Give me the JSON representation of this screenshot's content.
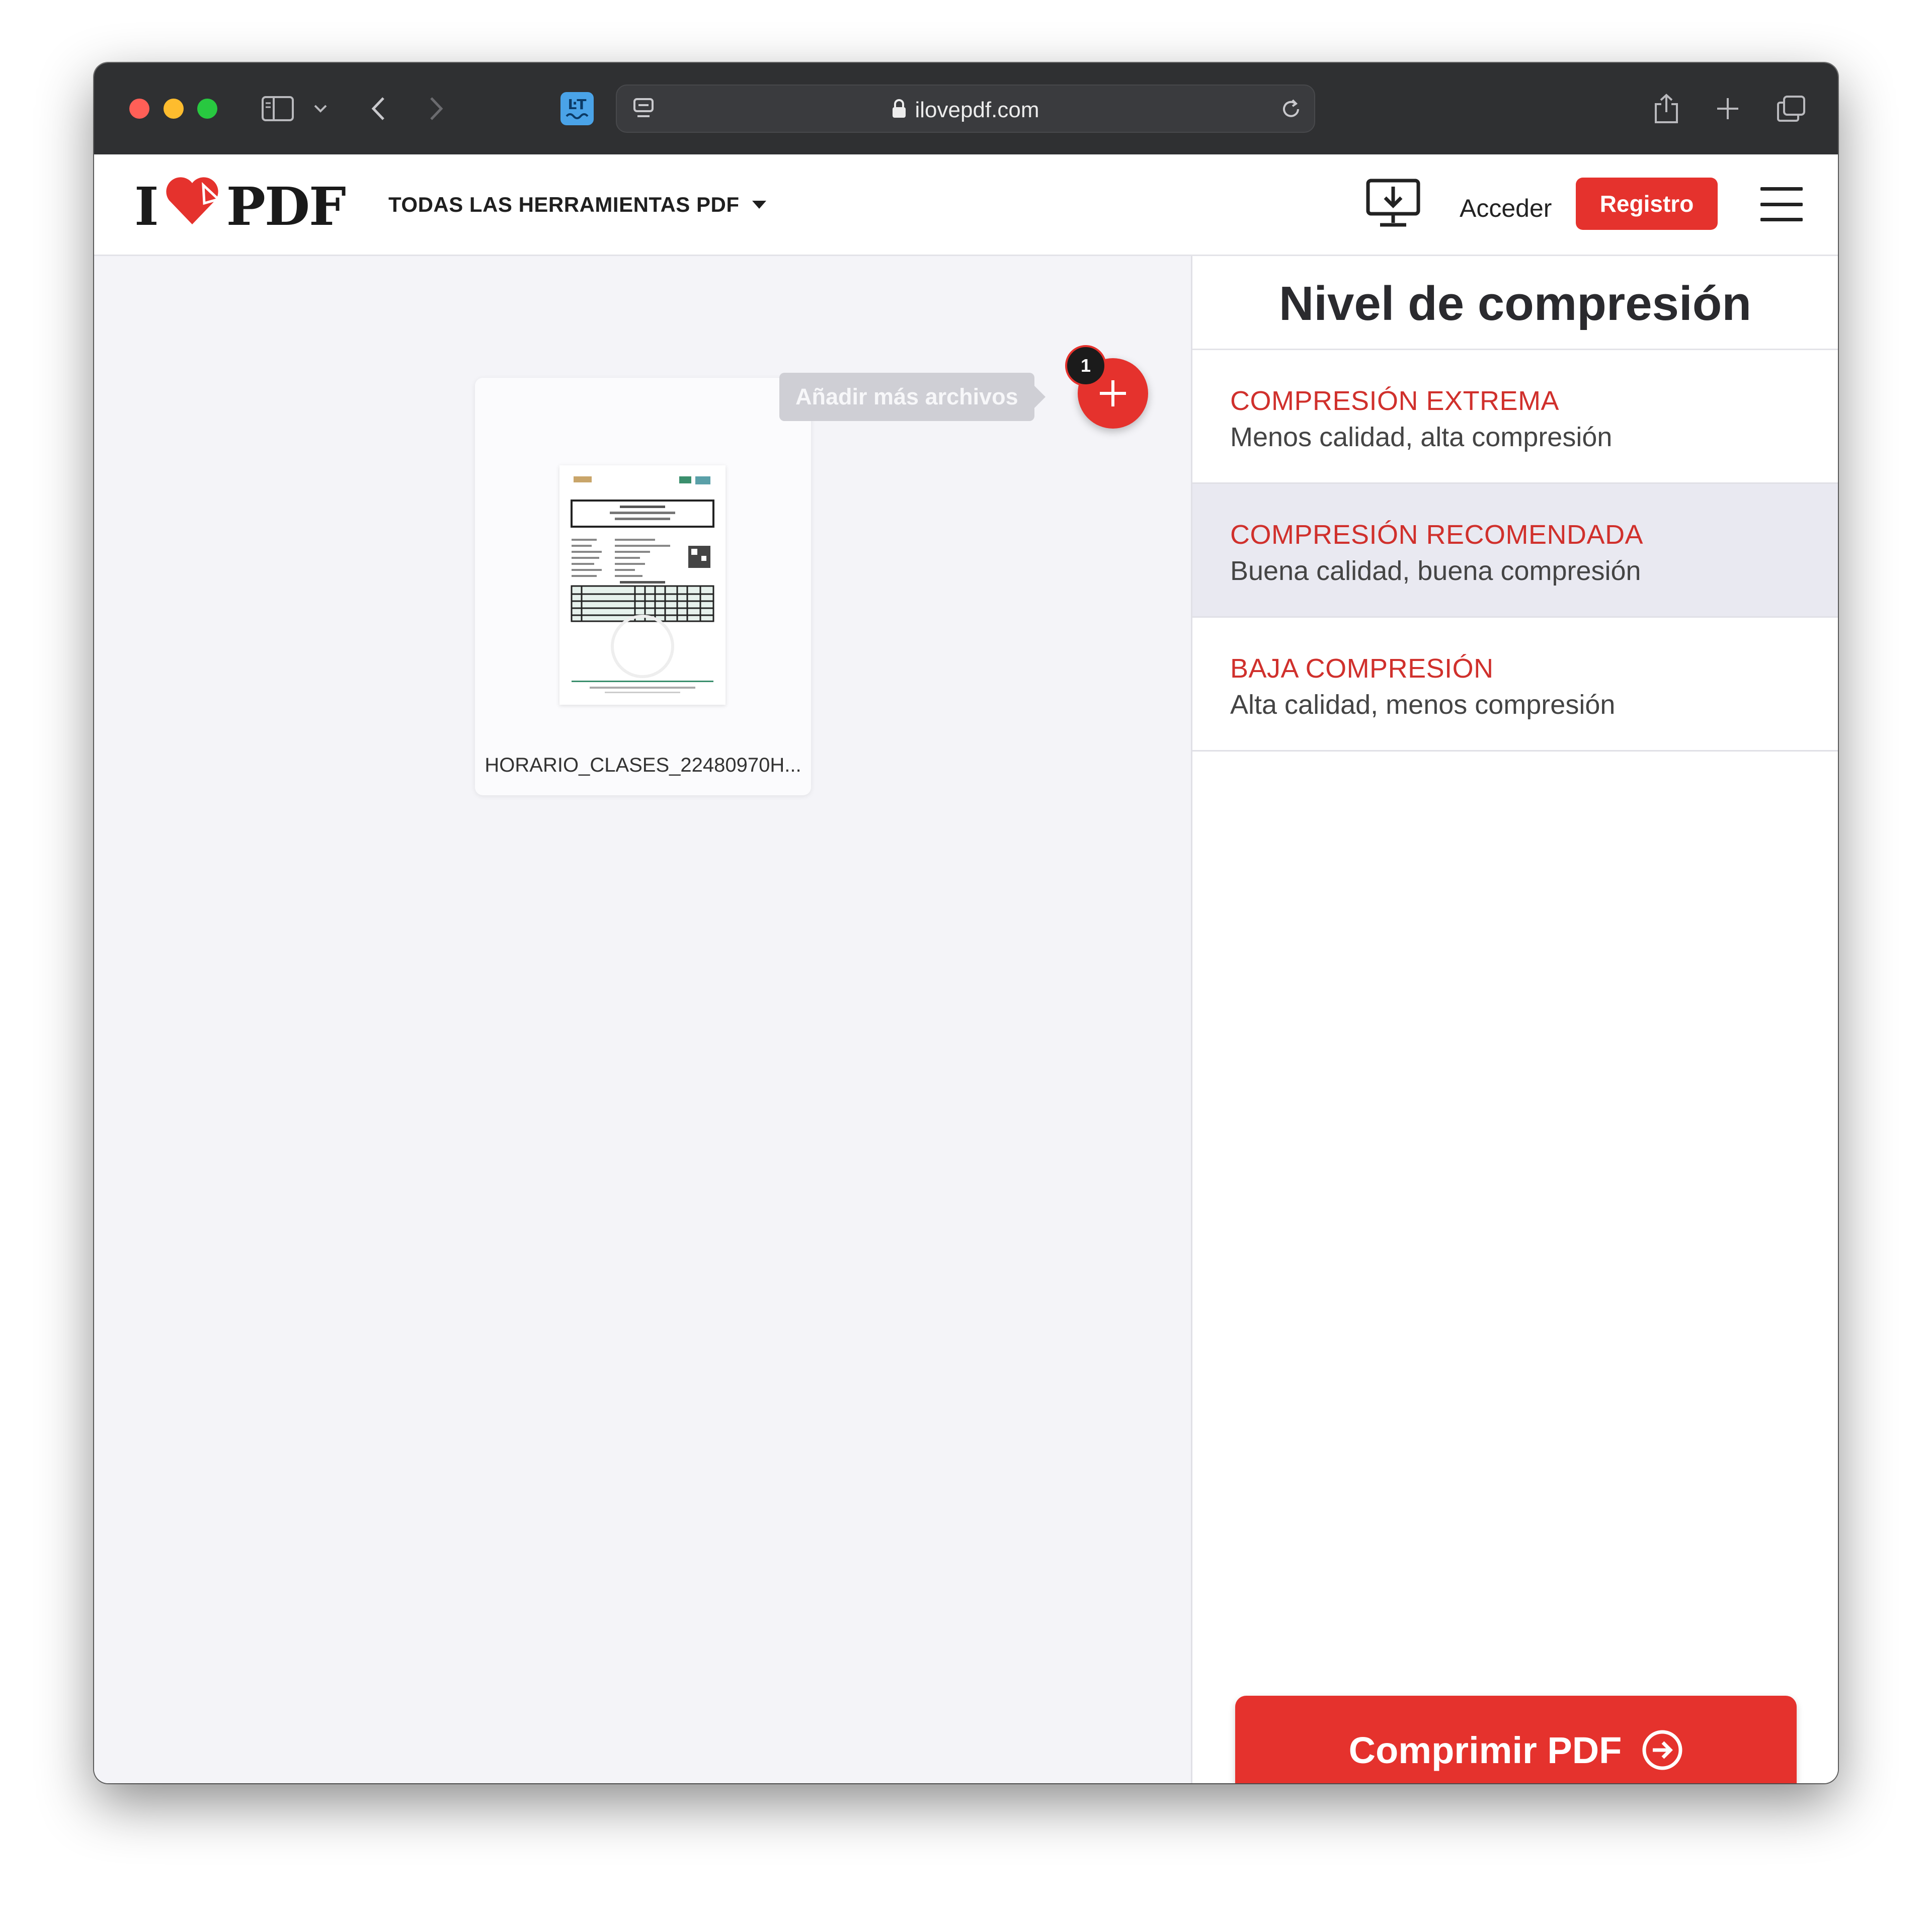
{
  "browser": {
    "url": "ilovepdf.com",
    "icons": [
      "sidebar-icon",
      "chevron-down-icon",
      "back-icon",
      "forward-icon",
      "translate-extension-icon",
      "tab-settings-icon",
      "lock-icon",
      "reload-icon",
      "share-icon",
      "new-tab-icon",
      "tab-overview-icon"
    ]
  },
  "header": {
    "logo_left": "I",
    "logo_right": "PDF",
    "tools_menu_label": "TODAS LAS HERRAMIENTAS PDF",
    "login_label": "Acceder",
    "signup_label": "Registro"
  },
  "workspace": {
    "file_name": "HORARIO_CLASES_22480970H...",
    "add_files_tooltip": "Añadir más archivos",
    "file_count": "1"
  },
  "sidebar": {
    "title": "Nivel de compresión",
    "options": [
      {
        "title": "COMPRESIÓN EXTREMA",
        "description": "Menos calidad, alta compresión",
        "selected": false
      },
      {
        "title": "COMPRESIÓN RECOMENDADA",
        "description": "Buena calidad, buena compresión",
        "selected": true
      },
      {
        "title": "BAJA COMPRESIÓN",
        "description": "Alta calidad, menos compresión",
        "selected": false
      }
    ],
    "submit_label": "Comprimir PDF"
  },
  "colors": {
    "brand_red": "#e5322d",
    "selected_bg": "#e9e9f1",
    "check_green": "#3cb46e",
    "titlebar": "#2f3032"
  }
}
